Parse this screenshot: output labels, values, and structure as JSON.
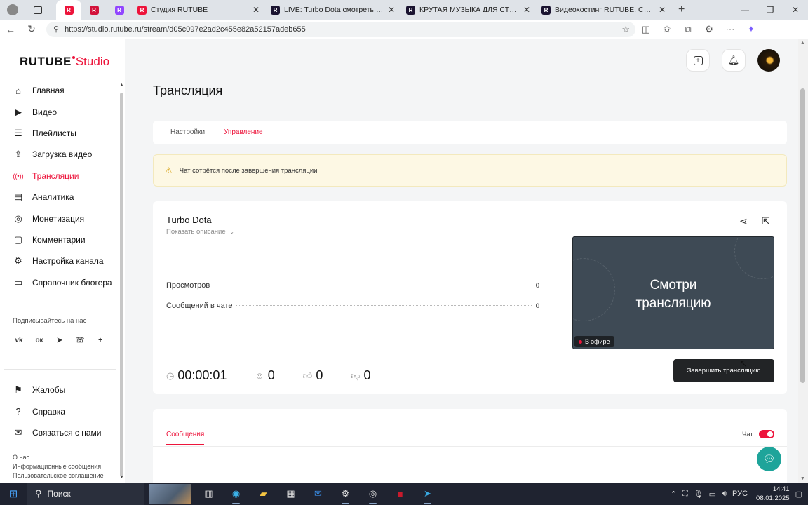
{
  "browser": {
    "tabs": [
      {
        "title": "",
        "icon": "rutube-studio-icon",
        "color": "#ed143b",
        "active": true,
        "small": true
      },
      {
        "title": "",
        "icon": "tv-icon",
        "color": "#d2123a",
        "small": true
      },
      {
        "title": "",
        "icon": "twitch-icon",
        "color": "#9146ff",
        "small": true
      },
      {
        "title": "Студия RUTUBE",
        "icon": "rutube-studio-icon",
        "color": "#ed143b"
      },
      {
        "title": "LIVE: Turbo Dota смотреть онлайн",
        "icon": "rutube-icon",
        "color": "#1a1330"
      },
      {
        "title": "КРУТАЯ МУЗЫКА ДЛЯ СТРИМА",
        "icon": "rutube-icon",
        "color": "#1a1330"
      },
      {
        "title": "Видеохостинг RUTUBE. Смотрите",
        "icon": "rutube-icon",
        "color": "#1a1330"
      }
    ],
    "url": "https://studio.rutube.ru/stream/d05c097e2ad2c455e82a52157adeb655"
  },
  "sidebar": {
    "logo_main": "RUTUBE",
    "logo_accent": "Studio",
    "items": [
      {
        "label": "Главная",
        "icon": "home-icon"
      },
      {
        "label": "Видео",
        "icon": "video-icon"
      },
      {
        "label": "Плейлисты",
        "icon": "playlist-icon"
      },
      {
        "label": "Загрузка видео",
        "icon": "upload-icon"
      },
      {
        "label": "Трансляции",
        "icon": "broadcast-icon",
        "active": true
      },
      {
        "label": "Аналитика",
        "icon": "analytics-icon"
      },
      {
        "label": "Монетизация",
        "icon": "monetization-icon"
      },
      {
        "label": "Комментарии",
        "icon": "comments-icon"
      },
      {
        "label": "Настройка канала",
        "icon": "settings-icon"
      },
      {
        "label": "Справочник блогера",
        "icon": "guide-icon"
      }
    ],
    "subscribe_label": "Подписывайтесь на нас",
    "socials": [
      {
        "name": "vk-icon",
        "glyph": "vk"
      },
      {
        "name": "ok-icon",
        "glyph": "ок"
      },
      {
        "name": "telegram-icon",
        "glyph": "➤"
      },
      {
        "name": "viber-icon",
        "glyph": "☏"
      },
      {
        "name": "more-icon",
        "glyph": "+"
      }
    ],
    "bottom_items": [
      {
        "label": "Жалобы",
        "icon": "complaints-icon"
      },
      {
        "label": "Справка",
        "icon": "help-icon"
      },
      {
        "label": "Связаться с нами",
        "icon": "mail-icon"
      }
    ],
    "footer_links": [
      "О нас",
      "Информационные сообщения",
      "Пользовательское соглашение"
    ]
  },
  "main": {
    "page_title": "Трансляция",
    "tabs": [
      {
        "label": "Настройки",
        "active": false
      },
      {
        "label": "Управление",
        "active": true
      }
    ],
    "warning": "Чат сотрётся после завершения трансляции",
    "stream": {
      "title": "Turbo Dota",
      "show_description": "Показать описание",
      "stats": [
        {
          "label": "Просмотров",
          "value": "0"
        },
        {
          "label": "Сообщений в чате",
          "value": "0"
        }
      ],
      "duration": "00:00:01",
      "viewers": "0",
      "likes": "0",
      "dislikes": "0",
      "preview_text_line1": "Смотри",
      "preview_text_line2": "трансляцию",
      "live_badge": "В эфире",
      "end_button": "Завершить трансляцию"
    },
    "messages_tab": "Сообщения",
    "chat_toggle_label": "Чат",
    "chat_enabled": true
  },
  "taskbar": {
    "search_placeholder": "Поиск",
    "language": "РУС",
    "time": "14:41",
    "date": "08.01.2025"
  },
  "colors": {
    "accent": "#ed143b",
    "fab": "#1ea49a"
  }
}
